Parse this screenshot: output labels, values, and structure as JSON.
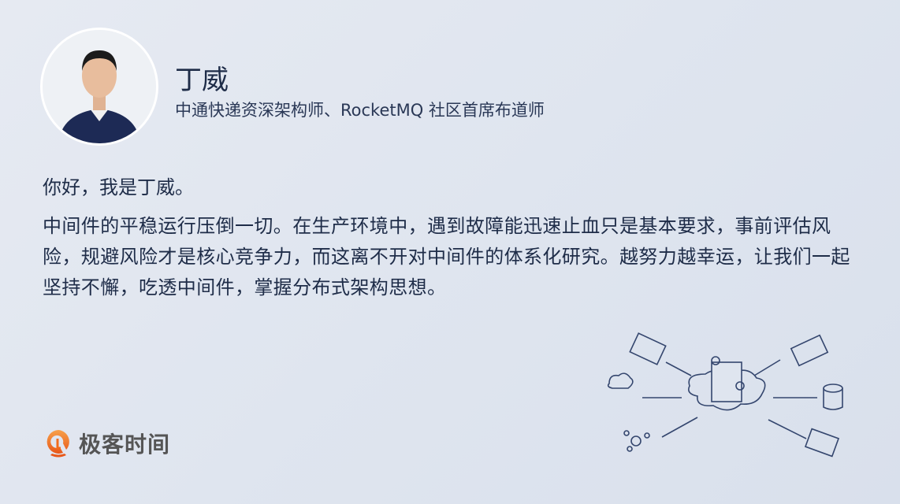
{
  "author": {
    "name": "丁威",
    "title": "中通快递资深架构师、RocketMQ 社区首席布道师"
  },
  "content": {
    "greeting": "你好，我是丁威。",
    "paragraph": "中间件的平稳运行压倒一切。在生产环境中，遇到故障能迅速止血只是基本要求，事前评估风险，规避风险才是核心竞争力，而这离不开对中间件的体系化研究。越努力越幸运，让我们一起坚持不懈，吃透中间件，掌握分布式架构思想。"
  },
  "brand": {
    "name": "极客时间",
    "color": "#f26b1d"
  }
}
